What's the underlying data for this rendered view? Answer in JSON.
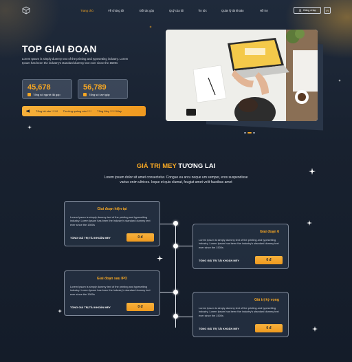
{
  "nav": {
    "items": [
      "Trang chủ",
      "Về chúng tôi",
      "Đối tác góp",
      "Quỹ của tôi",
      "Tin tức",
      "Quản lý tài khoản",
      "Hỗ trợ"
    ],
    "active_index": 0,
    "login_label": "Đăng nhập",
    "lang_label": "VI"
  },
  "hero": {
    "title": "TOP GIAI ĐOẠN",
    "description": "Lorem Ipsum is simply dummy text of the printing and typesetting industry. Lorem Ipsum has been the industry's standard dummy text ever since the 1500s",
    "stats": [
      {
        "value": "45,678",
        "label": "Tổng số người đã góp"
      },
      {
        "value": "56,789",
        "label": "Tổng số lượt góp"
      }
    ],
    "ticker": [
      "Tổng tài sản ****đ",
      "Thưởng quảng cáo ****",
      "Tổng Mey ******Mey"
    ]
  },
  "section": {
    "title_accent": "GIÁ TRỊ MEY",
    "title_rest": "TƯƠNG LAI",
    "description": "Lorem ipsum dolor sit amet consectetur. Congue eu arcu neque um semper, eros suspendisse varius enim ultrices. Ioque et quis clumat, feugiat amet velit faucibus amet"
  },
  "cards": [
    {
      "title": "Giai đoạn hiện tại",
      "text": "Lorem Ipsum is simply dummy text of the printing and typesetting industry. Lorem Ipsum has been the industry's standard dummy text ever since the 1500s",
      "label": "TỔNG GIÁ TRỊ TÀI KHOẢN MEY",
      "value": "0 đ"
    },
    {
      "title": "Giai đoạn 6",
      "text": "Lorem Ipsum is simply dummy text of the printing and typesetting industry. Lorem Ipsum has been the industry's standard dummy text ever since the 1500s",
      "label": "TỔNG GIÁ TRỊ TÀI KHOẢN MEY",
      "value": "0 đ"
    },
    {
      "title": "Giai đoạn sau IPO",
      "text": "Lorem Ipsum is simply dummy text of the printing and typesetting industry. Lorem Ipsum has been the industry's standard dummy text ever since the 1500s",
      "label": "TỔNG GIÁ TRỊ TÀI KHOẢN MEY",
      "value": "0 đ"
    },
    {
      "title": "Giá trị kỳ vọng",
      "text": "Lorem Ipsum is simply dummy text of the printing and typesetting industry. Lorem Ipsum has been the industry's standard dummy text ever since the 1500s",
      "label": "TỔNG GIÁ TRỊ TÀI KHOẢN MEY",
      "value": "0 đ"
    }
  ],
  "colors": {
    "accent": "#f5a623",
    "background": "#18212f"
  }
}
